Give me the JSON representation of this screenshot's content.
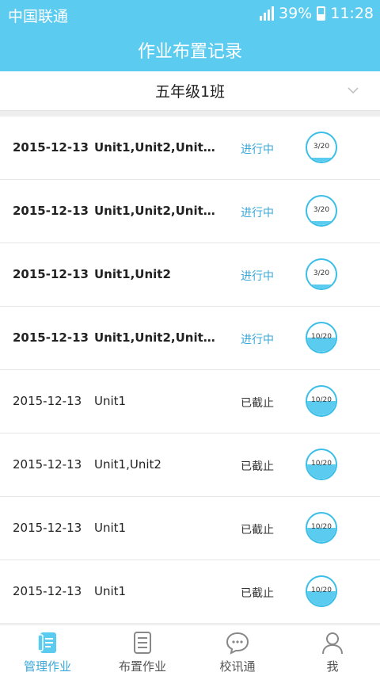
{
  "status_bar": {
    "carrier": "中国联通",
    "battery": "39%",
    "time": "11:28"
  },
  "header": {
    "title": "作业布置记录"
  },
  "class_selector": {
    "selected": "五年级1班",
    "icon": "chevron-down-icon"
  },
  "assignments": [
    {
      "date": "2015-12-13",
      "units": "Unit1,Unit2,Unit3...",
      "status": "进行中",
      "state": "active",
      "submitted": "3/20",
      "fraction": 0.15
    },
    {
      "date": "2015-12-13",
      "units": "Unit1,Unit2,Unit3...",
      "status": "进行中",
      "state": "active",
      "submitted": "3/20",
      "fraction": 0.15
    },
    {
      "date": "2015-12-13",
      "units": "Unit1,Unit2",
      "status": "进行中",
      "state": "active",
      "submitted": "3/20",
      "fraction": 0.15
    },
    {
      "date": "2015-12-13",
      "units": "Unit1,Unit2,Unit3...",
      "status": "进行中",
      "state": "active",
      "submitted": "10/20",
      "fraction": 0.5
    },
    {
      "date": "2015-12-13",
      "units": "Unit1",
      "status": "已截止",
      "state": "closed",
      "submitted": "10/20",
      "fraction": 0.5
    },
    {
      "date": "2015-12-13",
      "units": "Unit1,Unit2",
      "status": "已截止",
      "state": "closed",
      "submitted": "10/20",
      "fraction": 0.5
    },
    {
      "date": "2015-12-13",
      "units": "Unit1",
      "status": "已截止",
      "state": "closed",
      "submitted": "10/20",
      "fraction": 0.5
    },
    {
      "date": "2015-12-13",
      "units": "Unit1",
      "status": "已截止",
      "state": "closed",
      "submitted": "10/20",
      "fraction": 0.5
    }
  ],
  "tabs": [
    {
      "label": "管理作业",
      "icon": "notebook-icon",
      "selected": true
    },
    {
      "label": "布置作业",
      "icon": "document-list-icon",
      "selected": false
    },
    {
      "label": "校讯通",
      "icon": "chat-bubble-icon",
      "selected": false
    },
    {
      "label": "我",
      "icon": "person-icon",
      "selected": false
    }
  ],
  "colors": {
    "accent": "#5ccbf0",
    "active_status": "#3aa8d9"
  }
}
